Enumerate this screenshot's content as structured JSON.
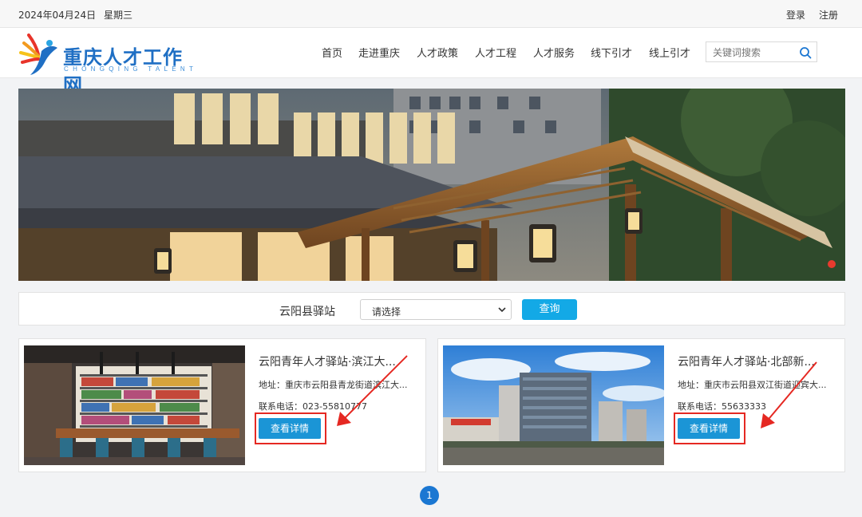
{
  "topbar": {
    "date": "2024年04月24日",
    "weekday": "星期三",
    "login": "登录",
    "register": "注册"
  },
  "logo": {
    "name": "重庆人才工作网",
    "subtitle": "CHONGQING TALENT"
  },
  "nav": [
    "首页",
    "走进重庆",
    "人才政策",
    "人才工程",
    "人才服务",
    "线下引才",
    "线上引才"
  ],
  "search": {
    "placeholder": "关键词搜索",
    "icon": "search-icon"
  },
  "filter": {
    "label": "云阳县驿站",
    "select_value": "请选择",
    "query_button": "查询"
  },
  "cards": [
    {
      "title": "云阳青年人才驿站·滨江大...",
      "address": "地址：重庆市云阳县青龙街道滨江大...",
      "phone": "联系电话：023-55810777",
      "button": "查看详情"
    },
    {
      "title": "云阳青年人才驿站·北部新...",
      "address": "地址：重庆市云阳县双江街道迎宾大...",
      "phone": "联系电话：55633333",
      "button": "查看详情"
    }
  ],
  "pagination": {
    "current": "1"
  },
  "colors": {
    "accent": "#1b95d6",
    "query": "#13a9e6",
    "highlight": "#e52822",
    "brand": "#1f6fc4"
  }
}
